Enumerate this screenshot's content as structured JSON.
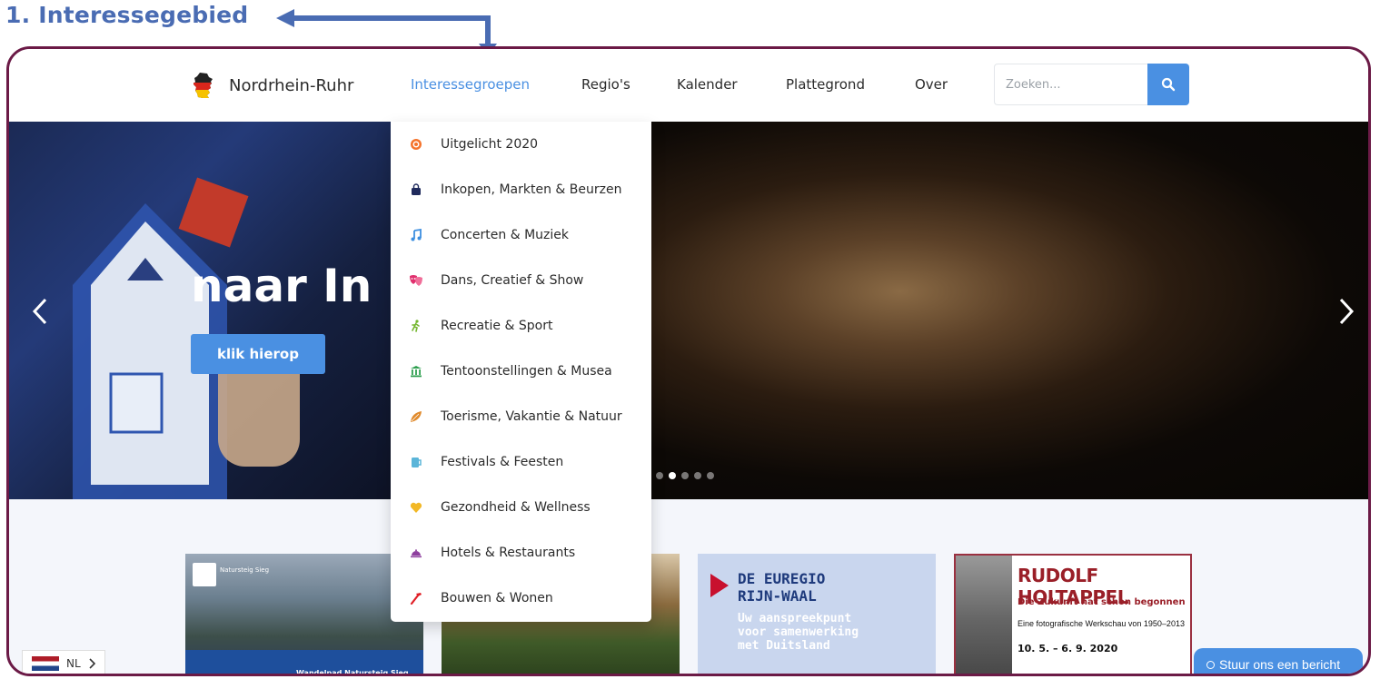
{
  "annotation": {
    "label": "1. Interessegebied"
  },
  "navbar": {
    "brand": "Nordrhein-Ruhr",
    "links": [
      {
        "label": "Interessegroepen",
        "active": true
      },
      {
        "label": "Regio's"
      },
      {
        "label": "Kalender"
      },
      {
        "label": "Plattegrond"
      },
      {
        "label": "Over"
      }
    ],
    "search_placeholder": "Zoeken...",
    "search_icon": "search-icon"
  },
  "hero": {
    "title": "naar In",
    "cta": "klik hierop",
    "slides": 5,
    "active_slide": 2
  },
  "dropdown": {
    "items": [
      {
        "label": "Uitgelicht 2020",
        "icon": "target-icon",
        "color": "#f5732b"
      },
      {
        "label": "Inkopen, Markten & Beurzen",
        "icon": "shopping-bag-icon",
        "color": "#1f2a5c"
      },
      {
        "label": "Concerten & Muziek",
        "icon": "music-note-icon",
        "color": "#3d8fe0"
      },
      {
        "label": "Dans, Creatief & Show",
        "icon": "theater-masks-icon",
        "color": "#e0306e"
      },
      {
        "label": "Recreatie & Sport",
        "icon": "running-person-icon",
        "color": "#74b62e"
      },
      {
        "label": "Tentoonstellingen & Musea",
        "icon": "museum-icon",
        "color": "#2e9f4f"
      },
      {
        "label": "Toerisme, Vakantie & Natuur",
        "icon": "leaf-icon",
        "color": "#e08a2c"
      },
      {
        "label": "Festivals & Feesten",
        "icon": "beer-mug-icon",
        "color": "#5bb5d9"
      },
      {
        "label": "Gezondheid & Wellness",
        "icon": "heart-icon",
        "color": "#f2b826"
      },
      {
        "label": "Hotels & Restaurants",
        "icon": "cloche-icon",
        "color": "#8e3f9e"
      },
      {
        "label": "Bouwen & Wonen",
        "icon": "hammer-icon",
        "color": "#e01f26"
      }
    ]
  },
  "cards": {
    "card1": {
      "logo_text": "Natursteig Sieg",
      "caption": "Wandelpad Natursteig Sieg"
    },
    "card3": {
      "title_line1": "DE EUREGIO",
      "title_line2": "RIJN-WAAL",
      "sub_line1": "Uw aanspreekpunt",
      "sub_line2": "voor samenwerking",
      "sub_line3": "met Duitsland"
    },
    "card4": {
      "title": "RUDOLF HOLTAPPEL",
      "subtitle": "Die Zukunft hat schon begonnen",
      "small": "Eine fotografische Werkschau von 1950–2013",
      "date": "10. 5. – 6. 9. 2020"
    }
  },
  "language": {
    "code": "NL"
  },
  "chat": {
    "label": "Stuur ons een bericht"
  },
  "colors": {
    "accent": "#4a90e2",
    "frame": "#6b1a46",
    "annotation": "#4a6cb3"
  }
}
